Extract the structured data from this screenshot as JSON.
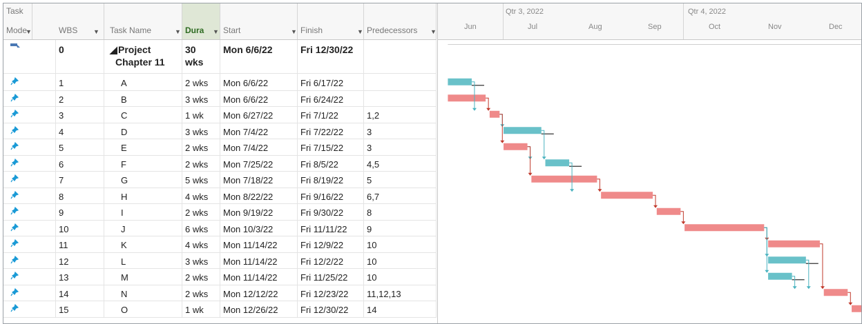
{
  "columns": {
    "task_mode_l1": "Task",
    "task_mode_l2": "Mode",
    "wbs": "WBS",
    "task_name": "Task Name",
    "duration": "Dura",
    "start": "Start",
    "finish": "Finish",
    "predecessors": "Predecessors"
  },
  "timescale": {
    "quarters": [
      "Qtr 3, 2022",
      "Qtr 4, 2022"
    ],
    "months": [
      "Jun",
      "Jul",
      "Aug",
      "Sep",
      "Oct",
      "Nov",
      "Dec"
    ]
  },
  "summary": {
    "wbs": "0",
    "name_line1": "Project",
    "name_line2": "Chapter 11",
    "duration_line1": "30",
    "duration_line2": "wks",
    "start": "Mon 6/6/22",
    "finish": "Fri 12/30/22",
    "predecessors": ""
  },
  "tasks": [
    {
      "wbs": "1",
      "name": "A",
      "duration": "2 wks",
      "start": "Mon 6/6/22",
      "finish": "Fri 6/17/22",
      "predecessors": "",
      "critical": false
    },
    {
      "wbs": "2",
      "name": "B",
      "duration": "3 wks",
      "start": "Mon 6/6/22",
      "finish": "Fri 6/24/22",
      "predecessors": "",
      "critical": true
    },
    {
      "wbs": "3",
      "name": "C",
      "duration": "1 wk",
      "start": "Mon 6/27/22",
      "finish": "Fri 7/1/22",
      "predecessors": "1,2",
      "critical": true
    },
    {
      "wbs": "4",
      "name": "D",
      "duration": "3 wks",
      "start": "Mon 7/4/22",
      "finish": "Fri 7/22/22",
      "predecessors": "3",
      "critical": false
    },
    {
      "wbs": "5",
      "name": "E",
      "duration": "2 wks",
      "start": "Mon 7/4/22",
      "finish": "Fri 7/15/22",
      "predecessors": "3",
      "critical": true
    },
    {
      "wbs": "6",
      "name": "F",
      "duration": "2 wks",
      "start": "Mon 7/25/22",
      "finish": "Fri 8/5/22",
      "predecessors": "4,5",
      "critical": false
    },
    {
      "wbs": "7",
      "name": "G",
      "duration": "5 wks",
      "start": "Mon 7/18/22",
      "finish": "Fri 8/19/22",
      "predecessors": "5",
      "critical": true
    },
    {
      "wbs": "8",
      "name": "H",
      "duration": "4 wks",
      "start": "Mon 8/22/22",
      "finish": "Fri 9/16/22",
      "predecessors": "6,7",
      "critical": true
    },
    {
      "wbs": "9",
      "name": "I",
      "duration": "2 wks",
      "start": "Mon 9/19/22",
      "finish": "Fri 9/30/22",
      "predecessors": "8",
      "critical": true
    },
    {
      "wbs": "10",
      "name": "J",
      "duration": "6 wks",
      "start": "Mon 10/3/22",
      "finish": "Fri 11/11/22",
      "predecessors": "9",
      "critical": true
    },
    {
      "wbs": "11",
      "name": "K",
      "duration": "4 wks",
      "start": "Mon 11/14/22",
      "finish": "Fri 12/9/22",
      "predecessors": "10",
      "critical": true
    },
    {
      "wbs": "12",
      "name": "L",
      "duration": "3 wks",
      "start": "Mon 11/14/22",
      "finish": "Fri 12/2/22",
      "predecessors": "10",
      "critical": false
    },
    {
      "wbs": "13",
      "name": "M",
      "duration": "2 wks",
      "start": "Mon 11/14/22",
      "finish": "Fri 11/25/22",
      "predecessors": "10",
      "critical": false
    },
    {
      "wbs": "14",
      "name": "N",
      "duration": "2 wks",
      "start": "Mon 12/12/22",
      "finish": "Fri 12/23/22",
      "predecessors": "11,12,13",
      "critical": true
    },
    {
      "wbs": "15",
      "name": "O",
      "duration": "1 wk",
      "start": "Mon 12/26/22",
      "finish": "Fri 12/30/22",
      "predecessors": "14",
      "critical": true
    }
  ],
  "colors": {
    "critical_bar": "#ef8a8a",
    "noncritical_bar": "#69c1c9",
    "pin_icon": "#1a9ad6",
    "link_critical": "#c0392b",
    "link_noncritical": "#4ab3c0",
    "active_header_bg": "#dfe7d6"
  },
  "icons": {
    "task_mode": "manual-pin-icon",
    "summary_mode": "summary-task-icon",
    "filter_dropdown": "chevron-down-icon"
  }
}
